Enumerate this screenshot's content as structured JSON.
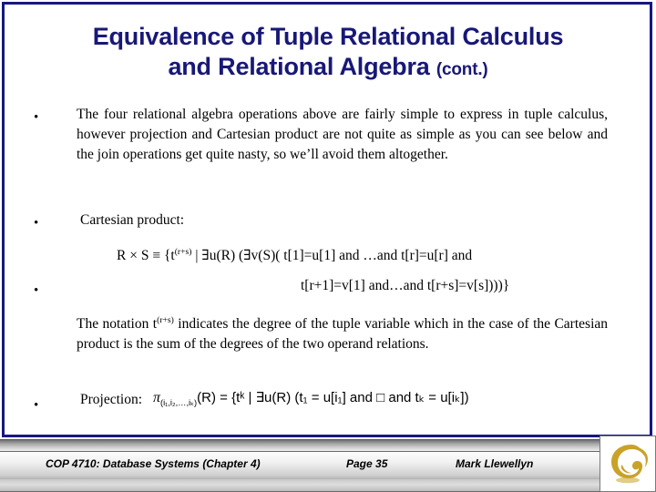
{
  "slide": {
    "title_main": "Equivalence of Tuple Relational Calculus and Relational Algebra",
    "title_line1": "Equivalence of Tuple Relational Calculus",
    "title_line2": "and Relational Algebra",
    "title_suffix": "(cont.)",
    "title_color": "#181878",
    "frame_color": "#171780",
    "background_color": "#ffffff"
  },
  "bullets": {
    "marker": "•",
    "b1_text": "The four relational algebra operations above are fairly simple to express in tuple calculus, however projection and Cartesian product are not quite as simple as you can see below and the join operations get quite nasty, so we’ll avoid them altogether.",
    "b2_text": "Cartesian product:",
    "b4_label": "Projection:"
  },
  "formulas": {
    "cartesian_line1_prefix": "R × S ≡ {t",
    "cartesian_line1_sup": "(r+s)",
    "cartesian_line1_rest": " | ∃u(R) (∃v(S)( t[1]=u[1] and …and t[r]=u[r] and",
    "cartesian_line2": "t[r+1]=v[1] and…and t[r+s]=v[s])))}",
    "notation_prefix": "The notation t",
    "notation_sup": "(r+s)",
    "notation_rest": " indicates the degree of the tuple variable which in the case of the Cartesian product is the sum of the degrees of the two operand relations.",
    "projection_pi": "π",
    "projection_pi_sub": "(i₁,i₂,…,iₖ)",
    "projection_body": "(R) = {tᵏ | ∃u(R) (t₁ = u[i₁] and □  and tₖ = u[iₖ])"
  },
  "footer": {
    "course": "COP 4710: Database Systems  (Chapter 4)",
    "page": "Page 35",
    "author": "Mark Llewellyn",
    "logo_name": "ucf-pegasus-logo",
    "logo_color": "#C9A227"
  }
}
